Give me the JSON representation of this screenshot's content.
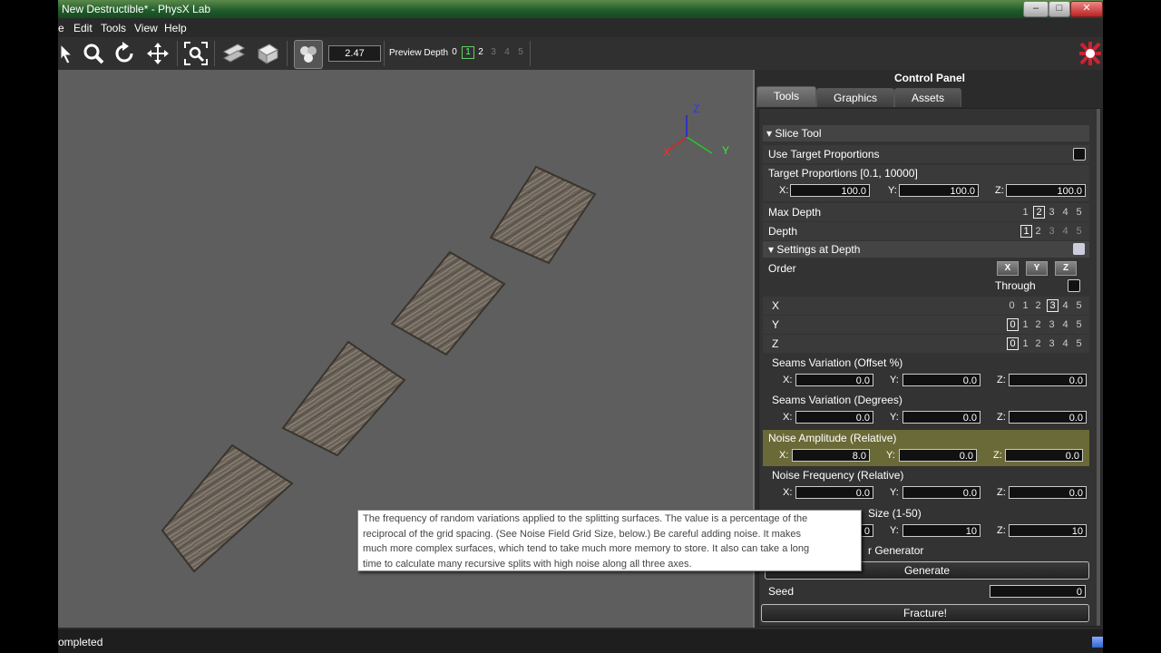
{
  "window": {
    "title": "New Destructible* - PhysX Lab",
    "btn_min": "–",
    "btn_max": "□",
    "btn_close": "✕"
  },
  "menu": {
    "items": [
      "e",
      "Edit",
      "Tools",
      "View",
      "Help"
    ]
  },
  "toolbar": {
    "speed_value": "2.47",
    "preview_label": "Preview Depth",
    "preview_depths": [
      "0",
      "1",
      "2",
      "3",
      "4",
      "5"
    ]
  },
  "status": {
    "text": "ompleted"
  },
  "panel": {
    "title": "Control Panel",
    "tabs": [
      "Tools",
      "Graphics",
      "Assets"
    ],
    "slice_tool": "▾ Slice Tool",
    "use_target_proportions": "Use Target Proportions",
    "target_proportions": "Target Proportions [0.1, 10000]",
    "target": {
      "x_label": "X:",
      "y_label": "Y:",
      "z_label": "Z:",
      "x": "100.0",
      "y": "100.0",
      "z": "100.0"
    },
    "max_depth_label": "Max Depth",
    "max_depth_digits": [
      "1",
      "2",
      "3",
      "4",
      "5"
    ],
    "depth_label": "Depth",
    "depth_digits": [
      "1",
      "2",
      "3",
      "4",
      "5"
    ],
    "settings_at_depth": "▾ Settings at Depth",
    "order_label": "Order",
    "order_buttons": [
      "X",
      "Y",
      "Z"
    ],
    "through_label": "Through",
    "axis_rows": [
      {
        "label": "X",
        "digits": [
          "0",
          "1",
          "2",
          "3",
          "4",
          "5"
        ]
      },
      {
        "label": "Y",
        "digits": [
          "0",
          "1",
          "2",
          "3",
          "4",
          "5"
        ]
      },
      {
        "label": "Z",
        "digits": [
          "0",
          "1",
          "2",
          "3",
          "4",
          "5"
        ]
      }
    ],
    "seams_offset": {
      "label": "Seams Variation (Offset %)",
      "x": "0.0",
      "y": "0.0",
      "z": "0.0"
    },
    "seams_degrees": {
      "label": "Seams Variation (Degrees)",
      "x": "0.0",
      "y": "0.0",
      "z": "0.0"
    },
    "noise_amplitude": {
      "label": "Noise Amplitude (Relative)",
      "x": "8.0",
      "y": "0.0",
      "z": "0.0"
    },
    "noise_frequency": {
      "label": "Noise Frequency (Relative)",
      "x": "0.0",
      "y": "0.0",
      "z": "0.0"
    },
    "grid_size": {
      "label": "Size (1-50)",
      "x": "0",
      "y": "10",
      "z": "10"
    },
    "generator_label": "r Generator",
    "generate_button": "Generate",
    "seed_label": "Seed",
    "seed_value": "0",
    "fracture_button": "Fracture!",
    "axis_letters": {
      "x": "X:",
      "y": "Y:",
      "z": "Z:"
    }
  },
  "tooltip": {
    "lines": [
      "The frequency of random variations applied to the splitting surfaces. The value is a percentage of the",
      "reciprocal of the grid spacing. (See Noise Field Grid Size, below.) Be careful adding noise. It makes",
      "much more complex surfaces, which tend to take much more memory to store. It also can take a long",
      "time to calculate many recursive splits with high noise along all three axes."
    ]
  },
  "gizmo": {
    "x": "X",
    "y": "Y",
    "z": "Z"
  }
}
